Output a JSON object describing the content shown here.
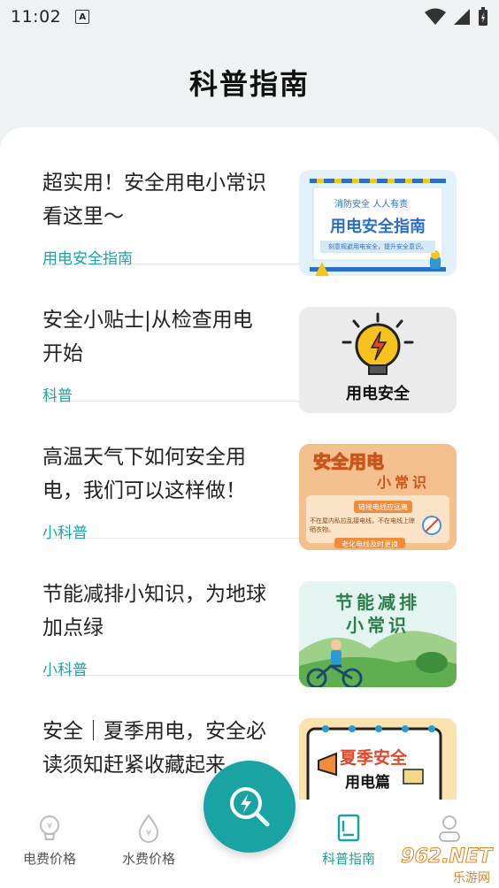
{
  "status_bar": {
    "time": "11:02",
    "notification_letter": "A"
  },
  "page": {
    "title": "科普指南"
  },
  "articles": [
    {
      "title": "超实用！安全用电小常识看这里～",
      "tag": "用电安全指南",
      "thumb": {
        "line1": "消防安全 人人有责",
        "headline": "用电安全指南",
        "subline": "刻意规避用电安全，提升安全意识。"
      }
    },
    {
      "title": "安全小贴士|从检查用电开始",
      "tag": "科普",
      "thumb": {
        "headline": "用电安全"
      }
    },
    {
      "title": "高温天气下如何安全用电，我们可以这样做！",
      "tag": "小科普",
      "thumb": {
        "headline": "安全用电",
        "subhead": "小常识",
        "note1": "链接电线应远离",
        "note2": "不在屋内私拉乱接电线，不在电线上晾晒衣物。",
        "note3": "老化电线及时更换"
      }
    },
    {
      "title": "节能减排小知识，为地球加点绿",
      "tag": "小科普",
      "thumb": {
        "headline": "节能减排",
        "subhead": "小常识"
      }
    },
    {
      "title": "安全｜夏季用电，安全必读须知赶紧收藏起来",
      "tag": "",
      "thumb": {
        "headline": "夏季安全",
        "subhead": "用电篇"
      }
    }
  ],
  "bottom_nav": {
    "items": [
      {
        "label": "电费价格",
        "icon": "lightbulb-icon"
      },
      {
        "label": "水费价格",
        "icon": "water-drop-icon"
      },
      {
        "label": "科普指南",
        "icon": "guide-book-icon",
        "active": true
      },
      {
        "label": "",
        "icon": "profile-icon"
      }
    ],
    "fab_icon": "search-lightning-icon"
  },
  "watermark": {
    "text": "962.NET",
    "subtext": "乐游网"
  },
  "colors": {
    "accent": "#1aa3a3",
    "background": "#eef2f2"
  }
}
